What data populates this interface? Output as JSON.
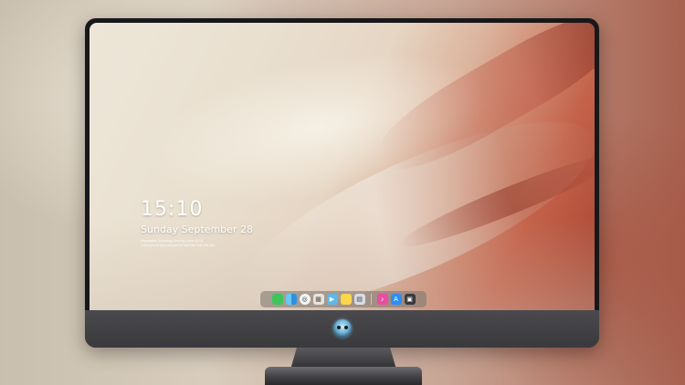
{
  "lock_screen": {
    "time": "15:10",
    "date": "Sunday September 28",
    "info_lines": [
      "Unavailable Technology Bearing Lorem Bl Ok",
      "Lorem ipsum dolor sit amet All Unit Dole Sole Site Dol"
    ]
  },
  "dock": {
    "items": [
      {
        "name": "messages",
        "icon": "messages-icon",
        "glyph": "",
        "color": "#3fc55a"
      },
      {
        "name": "finder",
        "icon": "finder-icon",
        "glyph": "",
        "color": "#2f8fe0"
      },
      {
        "name": "safari",
        "icon": "safari-icon",
        "glyph": "◎",
        "color": "#f4f4f4"
      },
      {
        "name": "photos",
        "icon": "photos-icon",
        "glyph": "▦",
        "color": "#e9e3da"
      },
      {
        "name": "video",
        "icon": "video-icon",
        "glyph": "▶",
        "color": "#5fb7e7"
      },
      {
        "name": "notes",
        "icon": "notes-icon",
        "glyph": "",
        "color": "#fbd64a"
      },
      {
        "name": "preview",
        "icon": "preview-icon",
        "glyph": "▤",
        "color": "#d7dce3"
      },
      {
        "name": "music",
        "icon": "music-icon",
        "glyph": "♪",
        "color": "#e84ea2"
      },
      {
        "name": "app-store",
        "icon": "app-store-icon",
        "glyph": "A",
        "color": "#2b8ff5"
      },
      {
        "name": "camera",
        "icon": "camera-icon",
        "glyph": "▣",
        "color": "#3a3a3c"
      }
    ]
  },
  "monitor": {
    "bezel_color": "#18181a",
    "chin_color": "#3a3a3d",
    "logo": "mascot-logo-icon"
  }
}
